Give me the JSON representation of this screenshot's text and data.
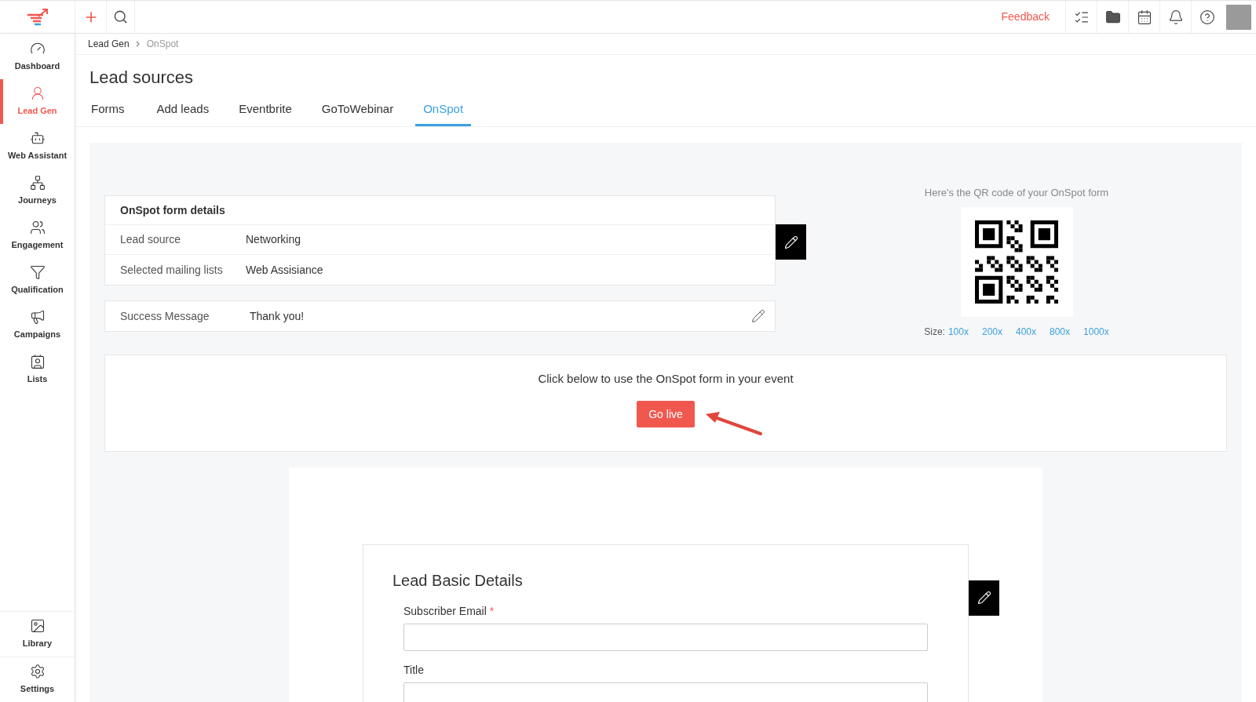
{
  "topbar": {
    "feedback": "Feedback"
  },
  "sidebar": {
    "items": [
      {
        "label": "Dashboard",
        "selected": false
      },
      {
        "label": "Lead Gen",
        "selected": true
      },
      {
        "label": "Web Assistant",
        "selected": false
      },
      {
        "label": "Journeys",
        "selected": false
      },
      {
        "label": "Engagement",
        "selected": false
      },
      {
        "label": "Qualification",
        "selected": false
      },
      {
        "label": "Campaigns",
        "selected": false
      },
      {
        "label": "Lists",
        "selected": false
      }
    ],
    "bottom_items": [
      {
        "label": "Library",
        "selected": false
      },
      {
        "label": "Settings",
        "selected": false
      }
    ]
  },
  "breadcrumb": [
    "Lead Gen",
    "OnSpot"
  ],
  "page_title": "Lead sources",
  "tabs": [
    {
      "label": "Forms",
      "selected": false
    },
    {
      "label": "Add leads",
      "selected": false
    },
    {
      "label": "Eventbrite",
      "selected": false
    },
    {
      "label": "GoToWebinar",
      "selected": false
    },
    {
      "label": "OnSpot",
      "selected": true
    }
  ],
  "details": {
    "title": "OnSpot form details",
    "rows": [
      {
        "label": "Lead source",
        "value": "Networking"
      },
      {
        "label": "Selected mailing lists",
        "value": "Web Assisiance"
      }
    ]
  },
  "success": {
    "label": "Success Message",
    "value": "Thank you!"
  },
  "qr": {
    "caption": "Here's the QR code of your OnSpot form",
    "size_label": "Size:",
    "sizes": [
      "100x",
      "200x",
      "400x",
      "800x",
      "1000x"
    ]
  },
  "go_live": {
    "text": "Click below to use the OnSpot form in your event",
    "button": "Go live"
  },
  "form_preview": {
    "title": "Lead Basic Details",
    "fields": [
      {
        "label": "Subscriber Email",
        "required_mark": "*"
      },
      {
        "label": "Title"
      }
    ]
  }
}
